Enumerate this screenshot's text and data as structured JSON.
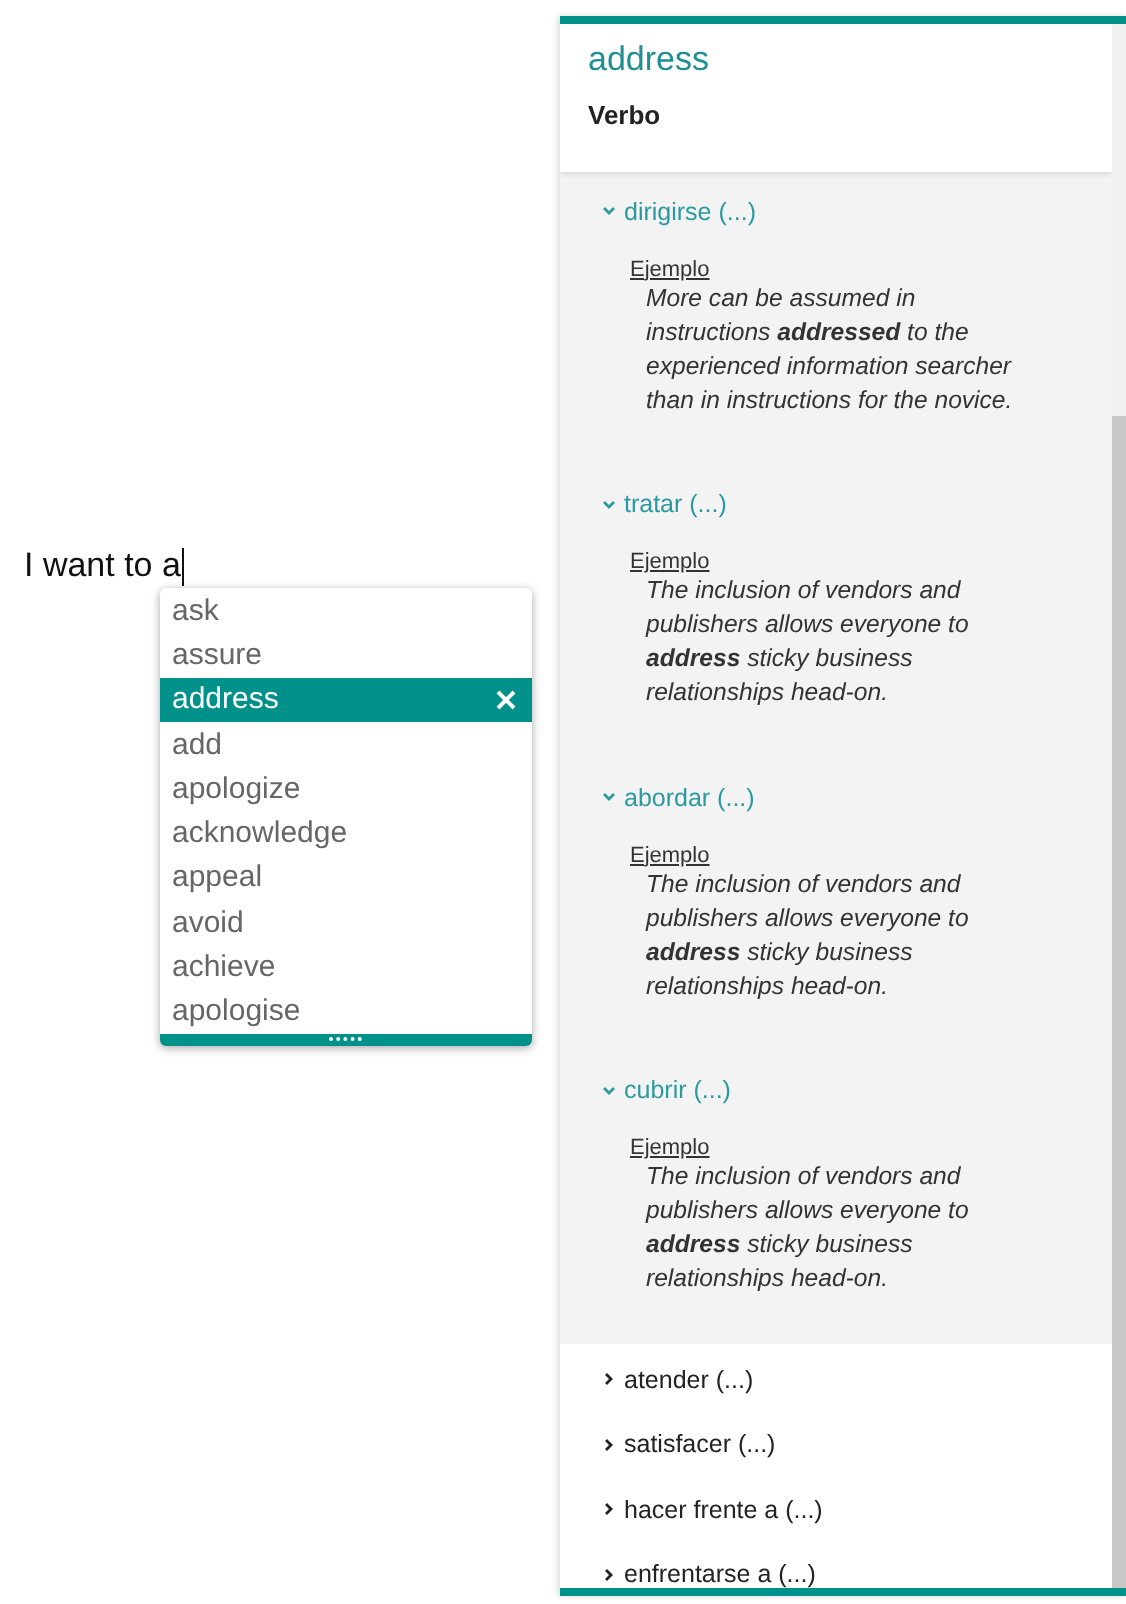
{
  "editor": {
    "text": "I want to a"
  },
  "suggestions": [
    {
      "label": "ask",
      "selected": false
    },
    {
      "label": "assure",
      "selected": false
    },
    {
      "label": "address",
      "selected": true
    },
    {
      "label": "add",
      "selected": false
    },
    {
      "label": "apologize",
      "selected": false
    },
    {
      "label": "acknowledge",
      "selected": false
    },
    {
      "label": "appeal",
      "selected": false
    },
    {
      "label": "avoid",
      "selected": false
    },
    {
      "label": "achieve",
      "selected": false
    },
    {
      "label": "apologise",
      "selected": false
    }
  ],
  "panel": {
    "word": "address",
    "part_of_speech": "Verbo",
    "senses": [
      {
        "label": "dirigirse (...)",
        "expanded": true,
        "example_label": "Ejemplo",
        "example": "More can be assumed in instructions **addressed** to the experienced information searcher than in instructions for the novice."
      },
      {
        "label": "tratar (...)",
        "expanded": true,
        "example_label": "Ejemplo",
        "example": "The inclusion of vendors and publishers allows everyone to **address** sticky business relationships head-on."
      },
      {
        "label": "abordar (...)",
        "expanded": true,
        "example_label": "Ejemplo",
        "example": "The inclusion of vendors and publishers allows everyone to **address** sticky business relationships head-on."
      },
      {
        "label": "cubrir (...)",
        "expanded": true,
        "example_label": "Ejemplo",
        "example": "The inclusion of vendors and publishers allows everyone to **address** sticky business relationships head-on."
      },
      {
        "label": "atender (...)",
        "expanded": false
      },
      {
        "label": "satisfacer (...)",
        "expanded": false
      },
      {
        "label": "hacer frente a (...)",
        "expanded": false
      },
      {
        "label": "enfrentarse a (...)",
        "expanded": false
      }
    ]
  }
}
